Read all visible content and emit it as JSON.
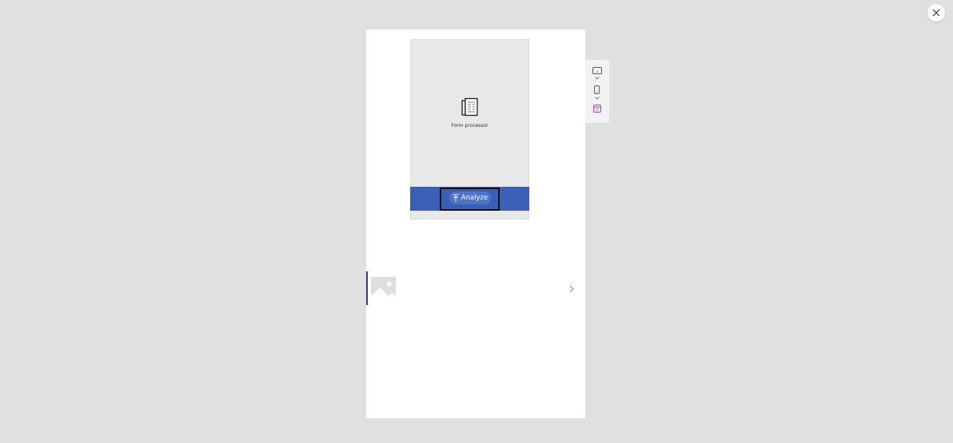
{
  "form": {
    "title": "Form processor",
    "analyze_label": "Analyze"
  },
  "icons": {
    "close": "close-icon",
    "document": "form-document-icon",
    "upload": "upload-arrow-icon",
    "image_placeholder": "image-placeholder-icon",
    "next": "chevron-right-icon",
    "toolbar": [
      "tablet-landscape-icon",
      "chevron-down-icon",
      "phone-portrait-icon",
      "chevron-down-icon",
      "calendar-app-icon"
    ]
  },
  "colors": {
    "background": "#e0e0e0",
    "panel": "#ffffff",
    "action_bar": "#3a5fb5",
    "button": "#5074c4",
    "row_accent": "#2b3a8c",
    "app_icon": "#8b3aa8"
  }
}
